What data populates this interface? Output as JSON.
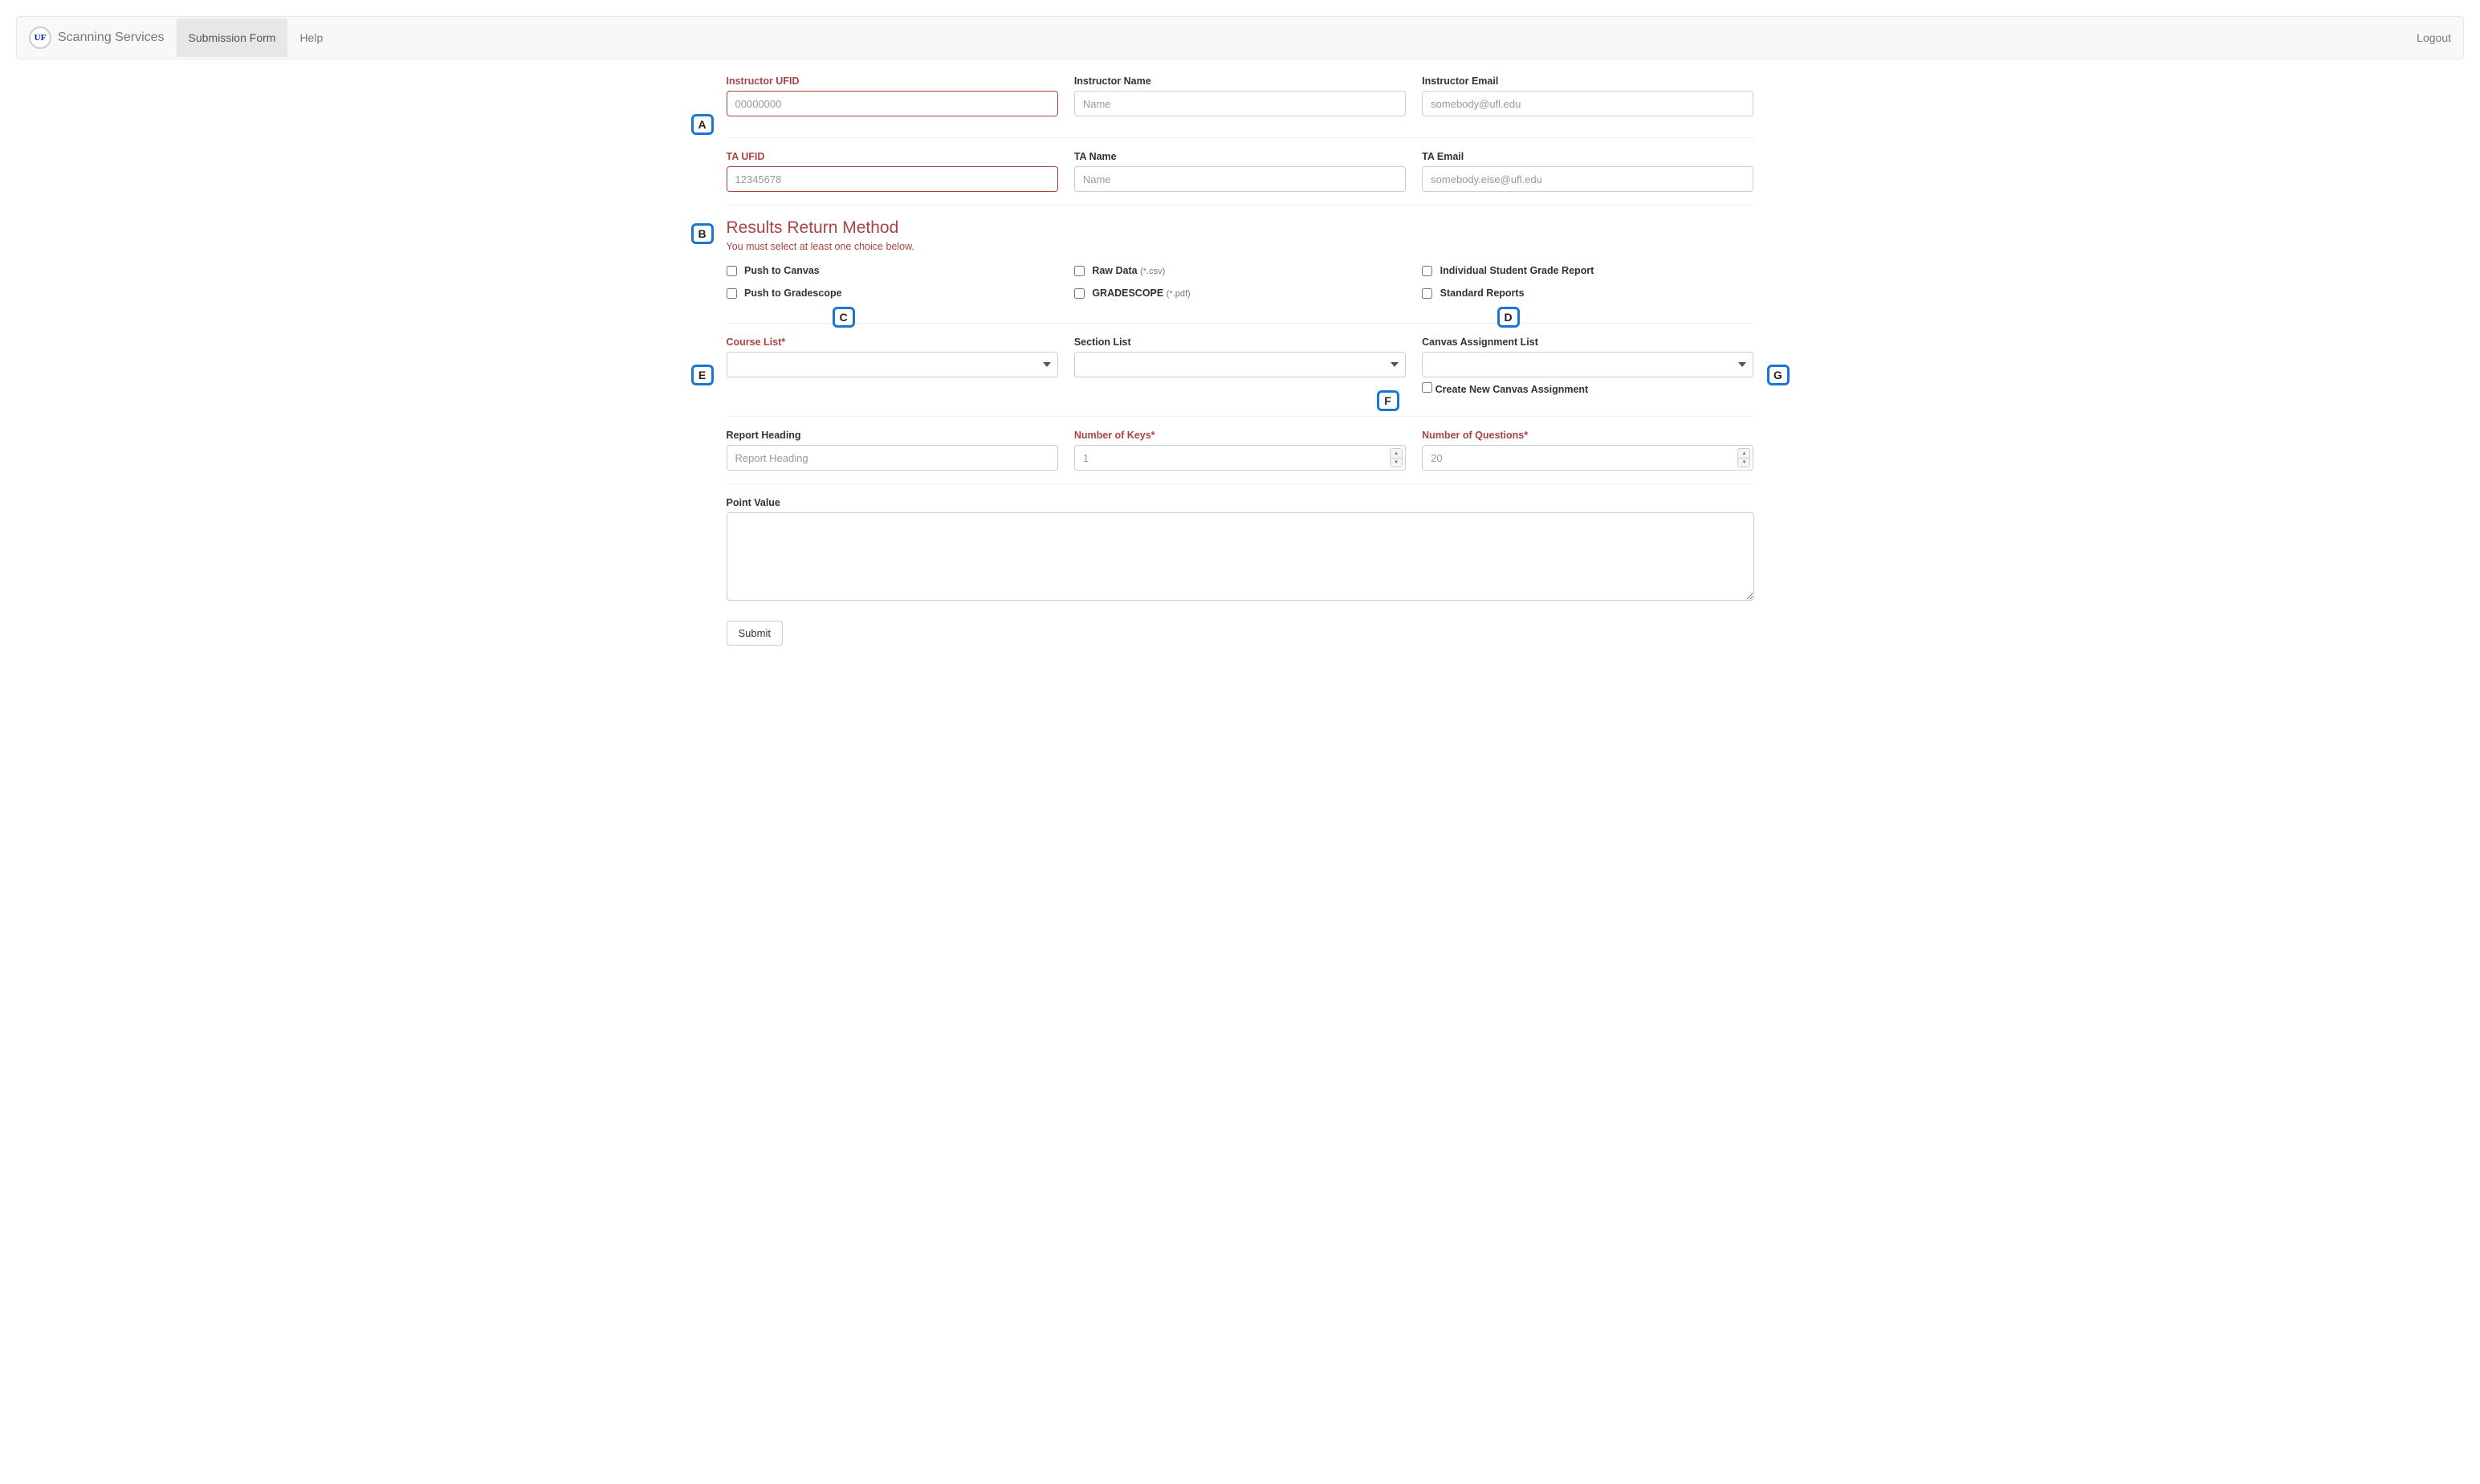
{
  "navbar": {
    "brand": "Scanning Services",
    "logo_text": "UF",
    "items": [
      {
        "label": "Submission Form",
        "active": true
      },
      {
        "label": "Help",
        "active": false
      }
    ],
    "logout": "Logout"
  },
  "instructor": {
    "ufid_label": "Instructor UFID",
    "ufid_placeholder": "00000000",
    "name_label": "Instructor Name",
    "name_placeholder": "Name",
    "email_label": "Instructor Email",
    "email_placeholder": "somebody@ufl.edu"
  },
  "ta": {
    "ufid_label": "TA UFID",
    "ufid_placeholder": "12345678",
    "name_label": "TA Name",
    "name_placeholder": "Name",
    "email_label": "TA Email",
    "email_placeholder": "somebody.else@ufl.edu"
  },
  "results": {
    "heading": "Results Return Method",
    "sub": "You must select at least one choice below.",
    "options": {
      "push_canvas": "Push to Canvas",
      "push_gradescope": "Push to Gradescope",
      "raw_data": "Raw Data",
      "raw_data_hint": "(*.csv)",
      "gradescope": "GRADESCOPE",
      "gradescope_hint": "(*.pdf)",
      "individual_report": "Individual Student Grade Report",
      "standard_reports": "Standard Reports"
    }
  },
  "lists": {
    "course_label": "Course List*",
    "section_label": "Section List",
    "canvas_label": "Canvas Assignment List",
    "create_new": "Create New Canvas Assignment"
  },
  "report": {
    "heading_label": "Report Heading",
    "heading_placeholder": "Report Heading",
    "keys_label": "Number of Keys*",
    "keys_placeholder": "1",
    "questions_label": "Number of Questions*",
    "questions_placeholder": "20"
  },
  "point_value": {
    "label": "Point Value"
  },
  "submit": "Submit",
  "markers": {
    "A": "A",
    "B": "B",
    "C": "C",
    "D": "D",
    "E": "E",
    "F": "F",
    "G": "G"
  }
}
